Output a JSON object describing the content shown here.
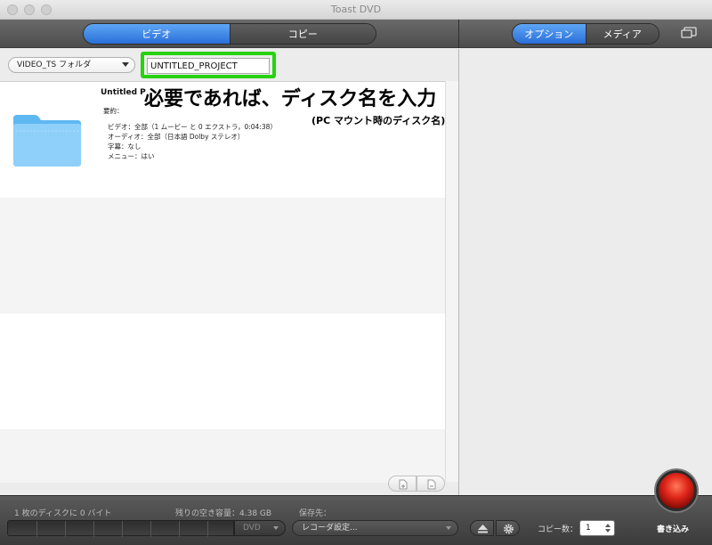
{
  "window": {
    "title": "Toast DVD"
  },
  "toolbar": {
    "left_tabs": [
      {
        "label": "ビデオ",
        "active": true
      },
      {
        "label": "コピー",
        "active": false
      }
    ],
    "right_tabs": [
      {
        "label": "オプション",
        "active": true
      },
      {
        "label": "メディア",
        "active": false
      }
    ],
    "screen_icon": "display-icon"
  },
  "source": {
    "folder_select": "VIDEO_TS フォルダ",
    "disc_name": "UNTITLED_PROJECT"
  },
  "item": {
    "title": "Untitled P",
    "summary_label": "要約：",
    "details": [
      "ビデオ：全部（1 ムービー と 0 エクストラ，0:04:38）",
      "オーディオ：全部（日本語 Dolby ステレオ）",
      "字幕：なし",
      "メニュー：はい"
    ],
    "icon": "folder-icon"
  },
  "annotation": {
    "headline": "必要であれば、ディスク名を入力",
    "sub": "(PC マウント時のディスク名)"
  },
  "bottom": {
    "disc_count": "1 枚のディスクに 0 バイト",
    "free_space": "残りの空き容量：4.38 GB",
    "destination_label": "保存先：",
    "media_type": "DVD",
    "recorder": "レコーダ設定...",
    "copies_label": "コピー数：",
    "copies_value": "1",
    "burn_label": "書き込み"
  },
  "colors": {
    "accent_blue": "#3a86e8",
    "highlight_green": "#27d211",
    "burn_red": "#e0261a"
  }
}
